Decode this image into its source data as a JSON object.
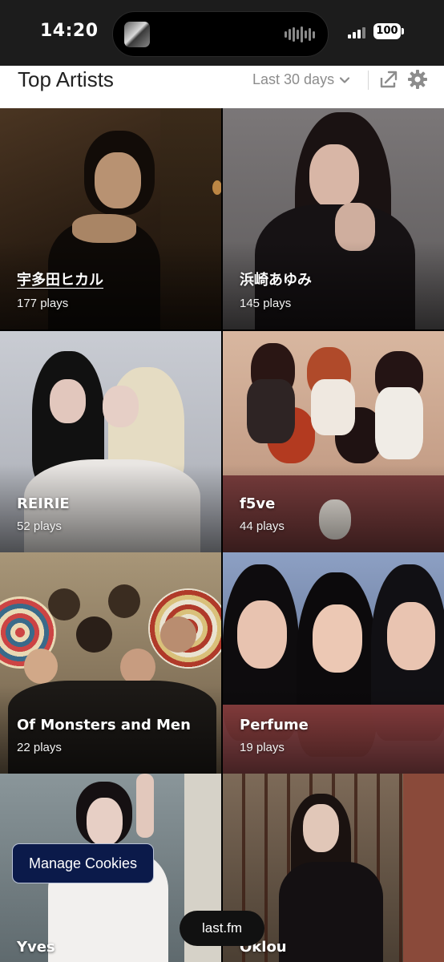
{
  "status_bar": {
    "time": "14:20",
    "battery": "100"
  },
  "header": {
    "title": "Top Artists",
    "period": "Last 30 days"
  },
  "artists": [
    {
      "name": "宇多田ヒカル",
      "plays": "177 plays",
      "bg": "#3a2a1a"
    },
    {
      "name": "浜崎あゆみ",
      "plays": "145 plays",
      "bg": "#6e6a6b"
    },
    {
      "name": "REIRIE",
      "plays": "52 plays",
      "bg": "#b9bcc4"
    },
    {
      "name": "f5ve",
      "plays": "44 plays",
      "bg": "#c9a58f"
    },
    {
      "name": "Of Monsters and Men",
      "plays": "22 plays",
      "bg": "#8a7a60"
    },
    {
      "name": "Perfume",
      "plays": "19 plays",
      "bg": "#6c7fa3"
    },
    {
      "name": "Yves",
      "plays": "",
      "bg": "#7e8b90"
    },
    {
      "name": "Oklou",
      "plays": "",
      "bg": "#6f5a45"
    }
  ],
  "overlays": {
    "cookies_label": "Manage Cookies",
    "brand_label": "last.fm"
  }
}
